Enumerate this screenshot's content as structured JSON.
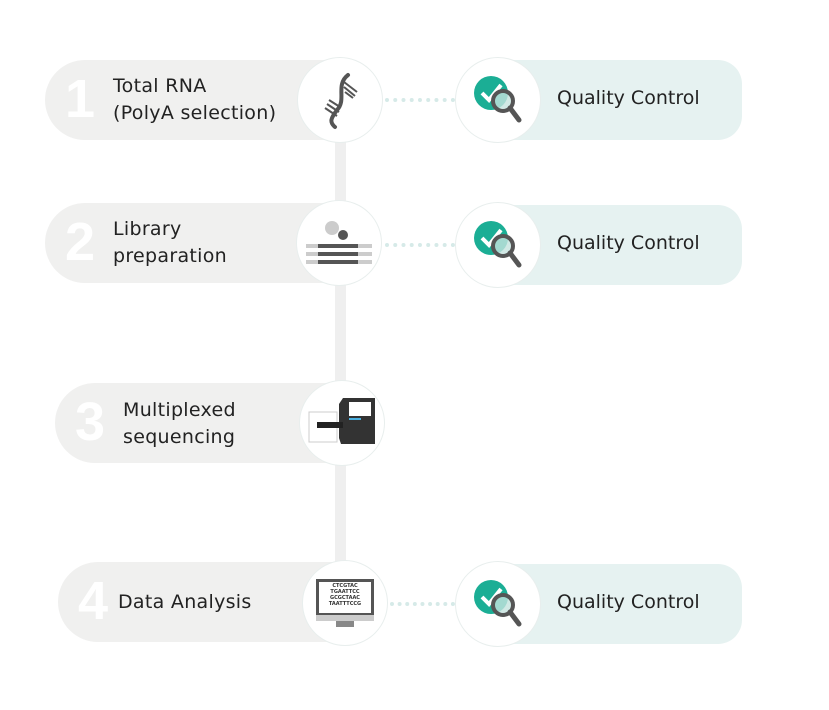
{
  "steps": [
    {
      "number": "1",
      "label_line1": "Total RNA",
      "label_line2": "(PolyA selection)",
      "icon": "dna-icon",
      "qc": true
    },
    {
      "number": "2",
      "label_line1": "Library",
      "label_line2": "preparation",
      "icon": "library-prep-icon",
      "qc": true
    },
    {
      "number": "3",
      "label_line1": "Multiplexed",
      "label_line2": "sequencing",
      "icon": "sequencer-icon",
      "qc": false
    },
    {
      "number": "4",
      "label_line1": "Data Analysis",
      "label_line2": "",
      "icon": "monitor-icon",
      "qc": true
    }
  ],
  "qc_label": "Quality Control",
  "monitor_text": [
    "CTCGTAC",
    "TGAATTCC",
    "GCGCTAAC",
    "TAATTTCCG"
  ],
  "colors": {
    "accent": "#1bae95",
    "qc_bg": "#e6f2f1",
    "step_bg": "#f0f0ef",
    "icon_dark": "#555555"
  }
}
